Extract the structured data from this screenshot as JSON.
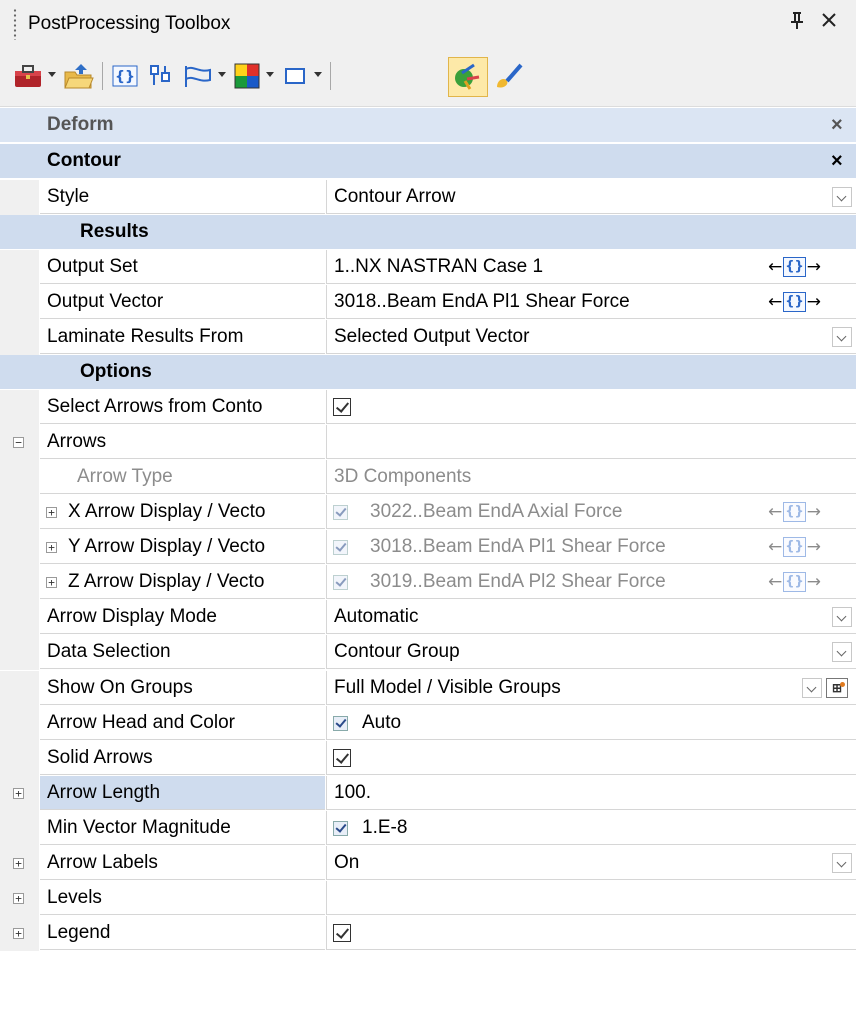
{
  "window": {
    "title": "PostProcessing Toolbox",
    "pin_glyph": "ᴘ",
    "close_glyph": "✕"
  },
  "toolbar": {
    "items": [
      {
        "icon": "toolbox-icon",
        "dropdown": true
      },
      {
        "icon": "open-folder-icon",
        "dropdown": false
      },
      {
        "icon": "output-set-icon",
        "dropdown": false
      },
      {
        "icon": "freebody-icon",
        "dropdown": false
      },
      {
        "icon": "flag-icon",
        "dropdown": true
      },
      {
        "icon": "contour-palette-icon",
        "dropdown": true
      },
      {
        "icon": "rectangle-icon",
        "dropdown": true
      },
      {
        "icon": "arrows-display-icon",
        "active": true
      },
      {
        "icon": "paintbrush-icon",
        "dropdown": false
      }
    ],
    "active_color": "#fde9a8"
  },
  "sections": {
    "deform": "Deform",
    "contour": "Contour",
    "results": "Results",
    "options": "Options",
    "close_glyph": "×"
  },
  "rows": {
    "style": {
      "name": "Style",
      "value": "Contour Arrow"
    },
    "output_set": {
      "name": "Output Set",
      "value": "1..NX NASTRAN Case 1"
    },
    "output_vector": {
      "name": "Output Vector",
      "value": "3018..Beam EndA Pl1 Shear Force"
    },
    "laminate": {
      "name": "Laminate Results From",
      "value": "Selected Output Vector"
    },
    "select_arrows": {
      "name": "Select Arrows from Conto",
      "checked": true
    },
    "arrows": {
      "name": "Arrows",
      "value": ""
    },
    "arrow_type": {
      "name": "Arrow Type",
      "value": "3D Components"
    },
    "x_arrow": {
      "name": "X Arrow Display / Vecto",
      "value": "3022..Beam EndA Axial Force",
      "checked": true
    },
    "y_arrow": {
      "name": "Y Arrow Display / Vecto",
      "value": "3018..Beam EndA Pl1 Shear Force",
      "checked": true
    },
    "z_arrow": {
      "name": "Z Arrow Display / Vecto",
      "value": "3019..Beam EndA Pl2 Shear Force",
      "checked": true
    },
    "arrow_display_mode": {
      "name": "Arrow Display Mode",
      "value": "Automatic"
    },
    "data_selection": {
      "name": "Data Selection",
      "value": "Contour Group"
    },
    "show_on_groups": {
      "name": "Show On Groups",
      "value": "Full Model / Visible Groups"
    },
    "arrow_head_color": {
      "name": "Arrow Head and Color",
      "value": "Auto",
      "checked": true
    },
    "solid_arrows": {
      "name": "Solid Arrows",
      "checked": true
    },
    "arrow_length": {
      "name": "Arrow Length",
      "value": "100."
    },
    "min_vector_mag": {
      "name": "Min Vector Magnitude",
      "value": "1.E-8",
      "checked": true
    },
    "arrow_labels": {
      "name": "Arrow Labels",
      "value": "On"
    },
    "levels": {
      "name": "Levels",
      "value": ""
    },
    "legend": {
      "name": "Legend",
      "checked": true
    }
  },
  "nav": {
    "left": "←",
    "braces": "{}",
    "right": "→"
  },
  "expander": {
    "collapse": "−",
    "expand": "+"
  },
  "group_icon_glyph": "⊞",
  "colors": {
    "section_bg": "#cfdcee",
    "gutter_bg": "#f0f0f0",
    "disabled_text": "#8c8c8c"
  }
}
